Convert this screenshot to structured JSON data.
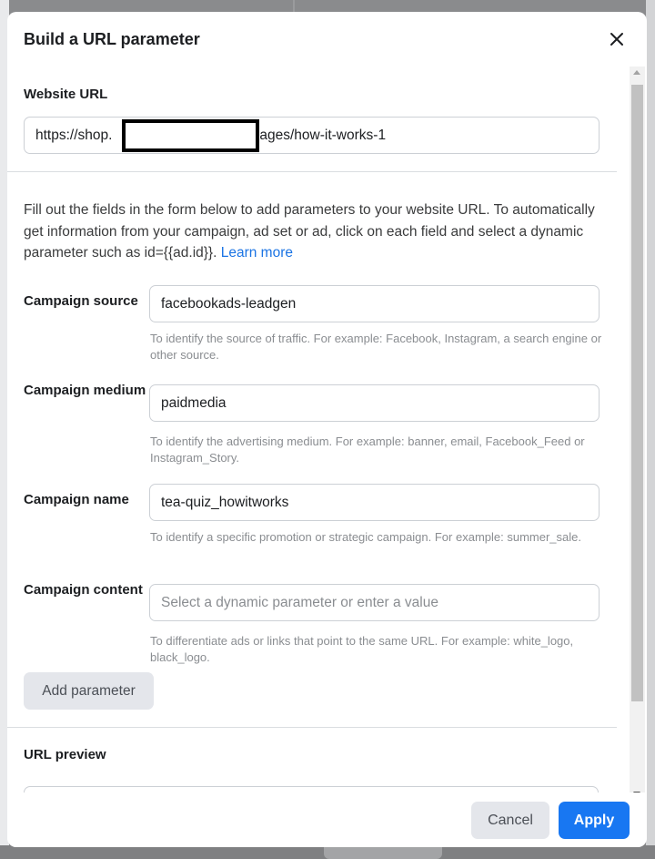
{
  "dialog": {
    "title": "Build a URL parameter"
  },
  "website": {
    "label": "Website URL",
    "url_prefix": "https://shop.",
    "url_suffix": "/pages/how-it-works-1"
  },
  "description": {
    "text": "Fill out the fields in the form below to add parameters to your website URL. To automatically get information from your campaign, ad set or ad, click on each field and select a dynamic parameter such as id={{ad.id}}.",
    "learn_more": "Learn more"
  },
  "fields": [
    {
      "label": "Campaign source",
      "value": "facebookads-leadgen",
      "placeholder": "",
      "help": "To identify the source of traffic. For example: Facebook, Instagram, a search engine or other source."
    },
    {
      "label": "Campaign medium",
      "value": "paidmedia",
      "placeholder": "",
      "help": "To identify the advertising medium. For example: banner, email, Facebook_Feed or Instagram_Story."
    },
    {
      "label": "Campaign name",
      "value": "tea-quiz_howitworks",
      "placeholder": "",
      "help": "To identify a specific promotion or strategic campaign. For example: summer_sale."
    },
    {
      "label": "Campaign content",
      "value": "",
      "placeholder": "Select a dynamic parameter or enter a value",
      "help": "To differentiate ads or links that point to the same URL. For example: white_logo, black_logo."
    }
  ],
  "add_parameter_label": "Add parameter",
  "preview": {
    "label": "URL preview"
  },
  "footer": {
    "cancel_label": "Cancel",
    "apply_label": "Apply"
  },
  "colors": {
    "primary": "#1877f2",
    "link": "#1b74e4",
    "secondary_button": "#e4e6eb"
  }
}
